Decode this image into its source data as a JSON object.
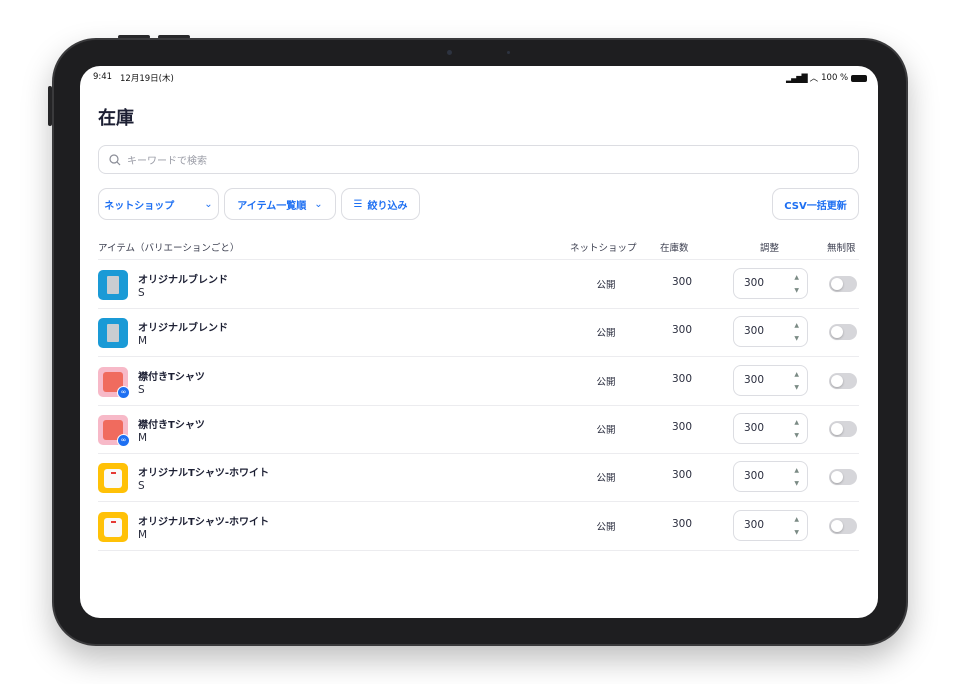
{
  "status_bar": {
    "time": "9:41",
    "date": "12月19日(木)",
    "battery": "100 %"
  },
  "page": {
    "title": "在庫"
  },
  "search": {
    "placeholder": "キーワードで検索"
  },
  "filters": {
    "shop": "ネットショップ",
    "sort": "アイテム一覧順",
    "filter": "絞り込み",
    "csv": "CSV一括更新"
  },
  "table": {
    "headers": {
      "item": "アイテム（バリエーションごと）",
      "shop": "ネットショップ",
      "stock": "在庫数",
      "adjust": "調整",
      "unlimited": "無制限"
    },
    "rows": [
      {
        "name": "オリジナルブレンド",
        "variant": "S",
        "shop": "公開",
        "stock": "300",
        "adjust": "300",
        "unlimited": false,
        "thumb": "coffee"
      },
      {
        "name": "オリジナルブレンド",
        "variant": "M",
        "shop": "公開",
        "stock": "300",
        "adjust": "300",
        "unlimited": false,
        "thumb": "coffee"
      },
      {
        "name": "襟付きTシャツ",
        "variant": "S",
        "shop": "公開",
        "stock": "300",
        "adjust": "300",
        "unlimited": false,
        "thumb": "red-shirt"
      },
      {
        "name": "襟付きTシャツ",
        "variant": "M",
        "shop": "公開",
        "stock": "300",
        "adjust": "300",
        "unlimited": false,
        "thumb": "red-shirt"
      },
      {
        "name": "オリジナルTシャツ-ホワイト",
        "variant": "S",
        "shop": "公開",
        "stock": "300",
        "adjust": "300",
        "unlimited": false,
        "thumb": "white-shirt"
      },
      {
        "name": "オリジナルTシャツ-ホワイト",
        "variant": "M",
        "shop": "公開",
        "stock": "300",
        "adjust": "300",
        "unlimited": false,
        "thumb": "white-shirt"
      }
    ]
  },
  "colors": {
    "accent": "#1d6ff2",
    "coffee": "#1a9ad6",
    "red_shirt_bg": "#f7b9c8",
    "white_shirt_bg": "#ffc107"
  }
}
